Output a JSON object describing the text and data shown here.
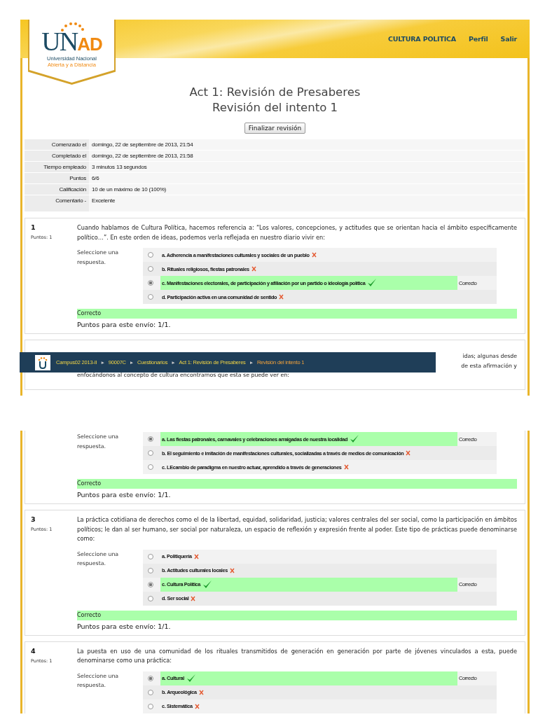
{
  "header": {
    "wordmark": [
      {
        "text": "UN",
        "highlighted": false
      },
      {
        "text": "AD",
        "highlighted": true
      }
    ],
    "tagline": [
      "Universidad Nacional",
      "Abierta y a Distancia"
    ],
    "nav": [
      {
        "label": "CULTURA POLITICA"
      },
      {
        "label": "Perfil"
      },
      {
        "label": "Salir"
      }
    ]
  },
  "pages": [
    {
      "blocks": [
        {
          "kind": "title",
          "lines": [
            "Act 1: Revisión de Presaberes",
            "Revisión del intento 1"
          ]
        },
        {
          "kind": "button",
          "label": "Finalizar revisión"
        },
        {
          "kind": "summary",
          "rows": [
            {
              "label": "Comenzado el",
              "value": "domingo, 22 de septiembre de 2013, 21:54"
            },
            {
              "label": "Completado el",
              "value": "domingo, 22 de septiembre de 2013, 21:58"
            },
            {
              "label": "Tiempo empleado",
              "value": "3 minutos 13 segundos"
            },
            {
              "label": "Puntos",
              "value": "6/6"
            },
            {
              "label": "Calificación",
              "value": "10 de un máximo de 10 (100%)"
            },
            {
              "label": "Comentario -",
              "value": "Excelente"
            }
          ]
        },
        {
          "kind": "question",
          "number": "1",
          "points": "Puntos: 1",
          "prompt": "Cuando hablamos de Cultura Política, hacemos referencia a: “Los valores, concepciones, y actitudes que se orientan hacia el ámbito específicamente político…”. En este orden de ideas, podemos verla reflejada en nuestro diario vivir en:",
          "select_label": "Seleccione una respuesta.",
          "options": [
            {
              "text": "a. Adherencia a manifestaciones culturales y sociales de un pueblo",
              "selected": false,
              "correct": false
            },
            {
              "text": "b. Rituales religiosos, fiestas patronales",
              "selected": false,
              "correct": false
            },
            {
              "text": "c. Manifestaciones electorales, de participación y afiliación por un partido o ideología política",
              "selected": true,
              "correct": true,
              "result": "Correcto"
            },
            {
              "text": "d. Participación activa en una comunidad de sentido",
              "selected": false,
              "correct": false
            }
          ],
          "feedback": "Correcto",
          "score": "Puntos para este envío: 1/1."
        },
        {
          "kind": "question",
          "prompt_lines": [
            {
              "text": "idas; algunas desde",
              "covered": true
            },
            {
              "text": "de esta afirmación y",
              "covered": true
            },
            {
              "text": "enfocándonos al concepto de cultura encontramos que esta se puede ver en:",
              "covered": false
            }
          ]
        }
      ]
    },
    {
      "blocks": [
        {
          "kind": "question",
          "select_label": "Seleccione una respuesta.",
          "options": [
            {
              "text": "a. Las fiestas patronales, carnavales y celebraciones arraigadas de nuestra localidad",
              "selected": true,
              "correct": true,
              "result": "Correcto"
            },
            {
              "text": "b. El seguimiento e imitación de manifestaciones culturales, socializadas a través de medios de comunicación",
              "selected": false,
              "correct": false
            },
            {
              "text": "c. LEcambio de paradigma en nuestro actuar, aprendido a través de generaciones",
              "selected": false,
              "correct": false
            }
          ],
          "feedback": "Correcto",
          "score": "Puntos para este envío: 1/1."
        },
        {
          "kind": "question",
          "number": "3",
          "points": "Puntos: 1",
          "prompt": "La práctica cotidiana de derechos como el de la libertad, equidad, solidaridad, justicia; valores centrales del ser social, como la participación en ámbitos políticos; le dan al ser humano, ser social por naturaleza, un espacio de reflexión y expresión frente al poder. Este tipo de prácticas puede denominarse como:",
          "select_label": "Seleccione una respuesta.",
          "options": [
            {
              "text": "a. Politiquería",
              "selected": false,
              "correct": false
            },
            {
              "text": "b. Actitudes culturales locales",
              "selected": false,
              "correct": false
            },
            {
              "text": "c. Cultura Política",
              "selected": true,
              "correct": true,
              "result": "Correcto"
            },
            {
              "text": "d. Ser social",
              "selected": false,
              "correct": false
            }
          ],
          "feedback": "Correcto",
          "score": "Puntos para este envío: 1/1."
        },
        {
          "kind": "question",
          "number": "4",
          "points": "Puntos: 1",
          "prompt": "La puesta en uso de una comunidad de los rituales transmitidos de generación en generación por parte de jóvenes vinculados a esta, puede denominarse como una práctica:",
          "select_label": "Seleccione una respuesta.",
          "options": [
            {
              "text": "a. Cultural",
              "selected": true,
              "correct": true,
              "result": "Correcto"
            },
            {
              "text": "b. Arqueológica",
              "selected": false,
              "correct": false
            },
            {
              "text": "c. Sistemática",
              "selected": false,
              "correct": false
            }
          ]
        }
      ]
    }
  ],
  "breadcrumb": [
    {
      "label": "Campus02 2013-II",
      "current": false
    },
    {
      "separator": "►",
      "label": "90007C",
      "current": false
    },
    {
      "separator": "►",
      "label": "Cuestionarios",
      "current": false
    },
    {
      "separator": "►",
      "label": "Act 1: Revisión de Presaberes",
      "current": false
    },
    {
      "separator": "►",
      "label": "Revisión del intento 1",
      "current": true
    }
  ]
}
